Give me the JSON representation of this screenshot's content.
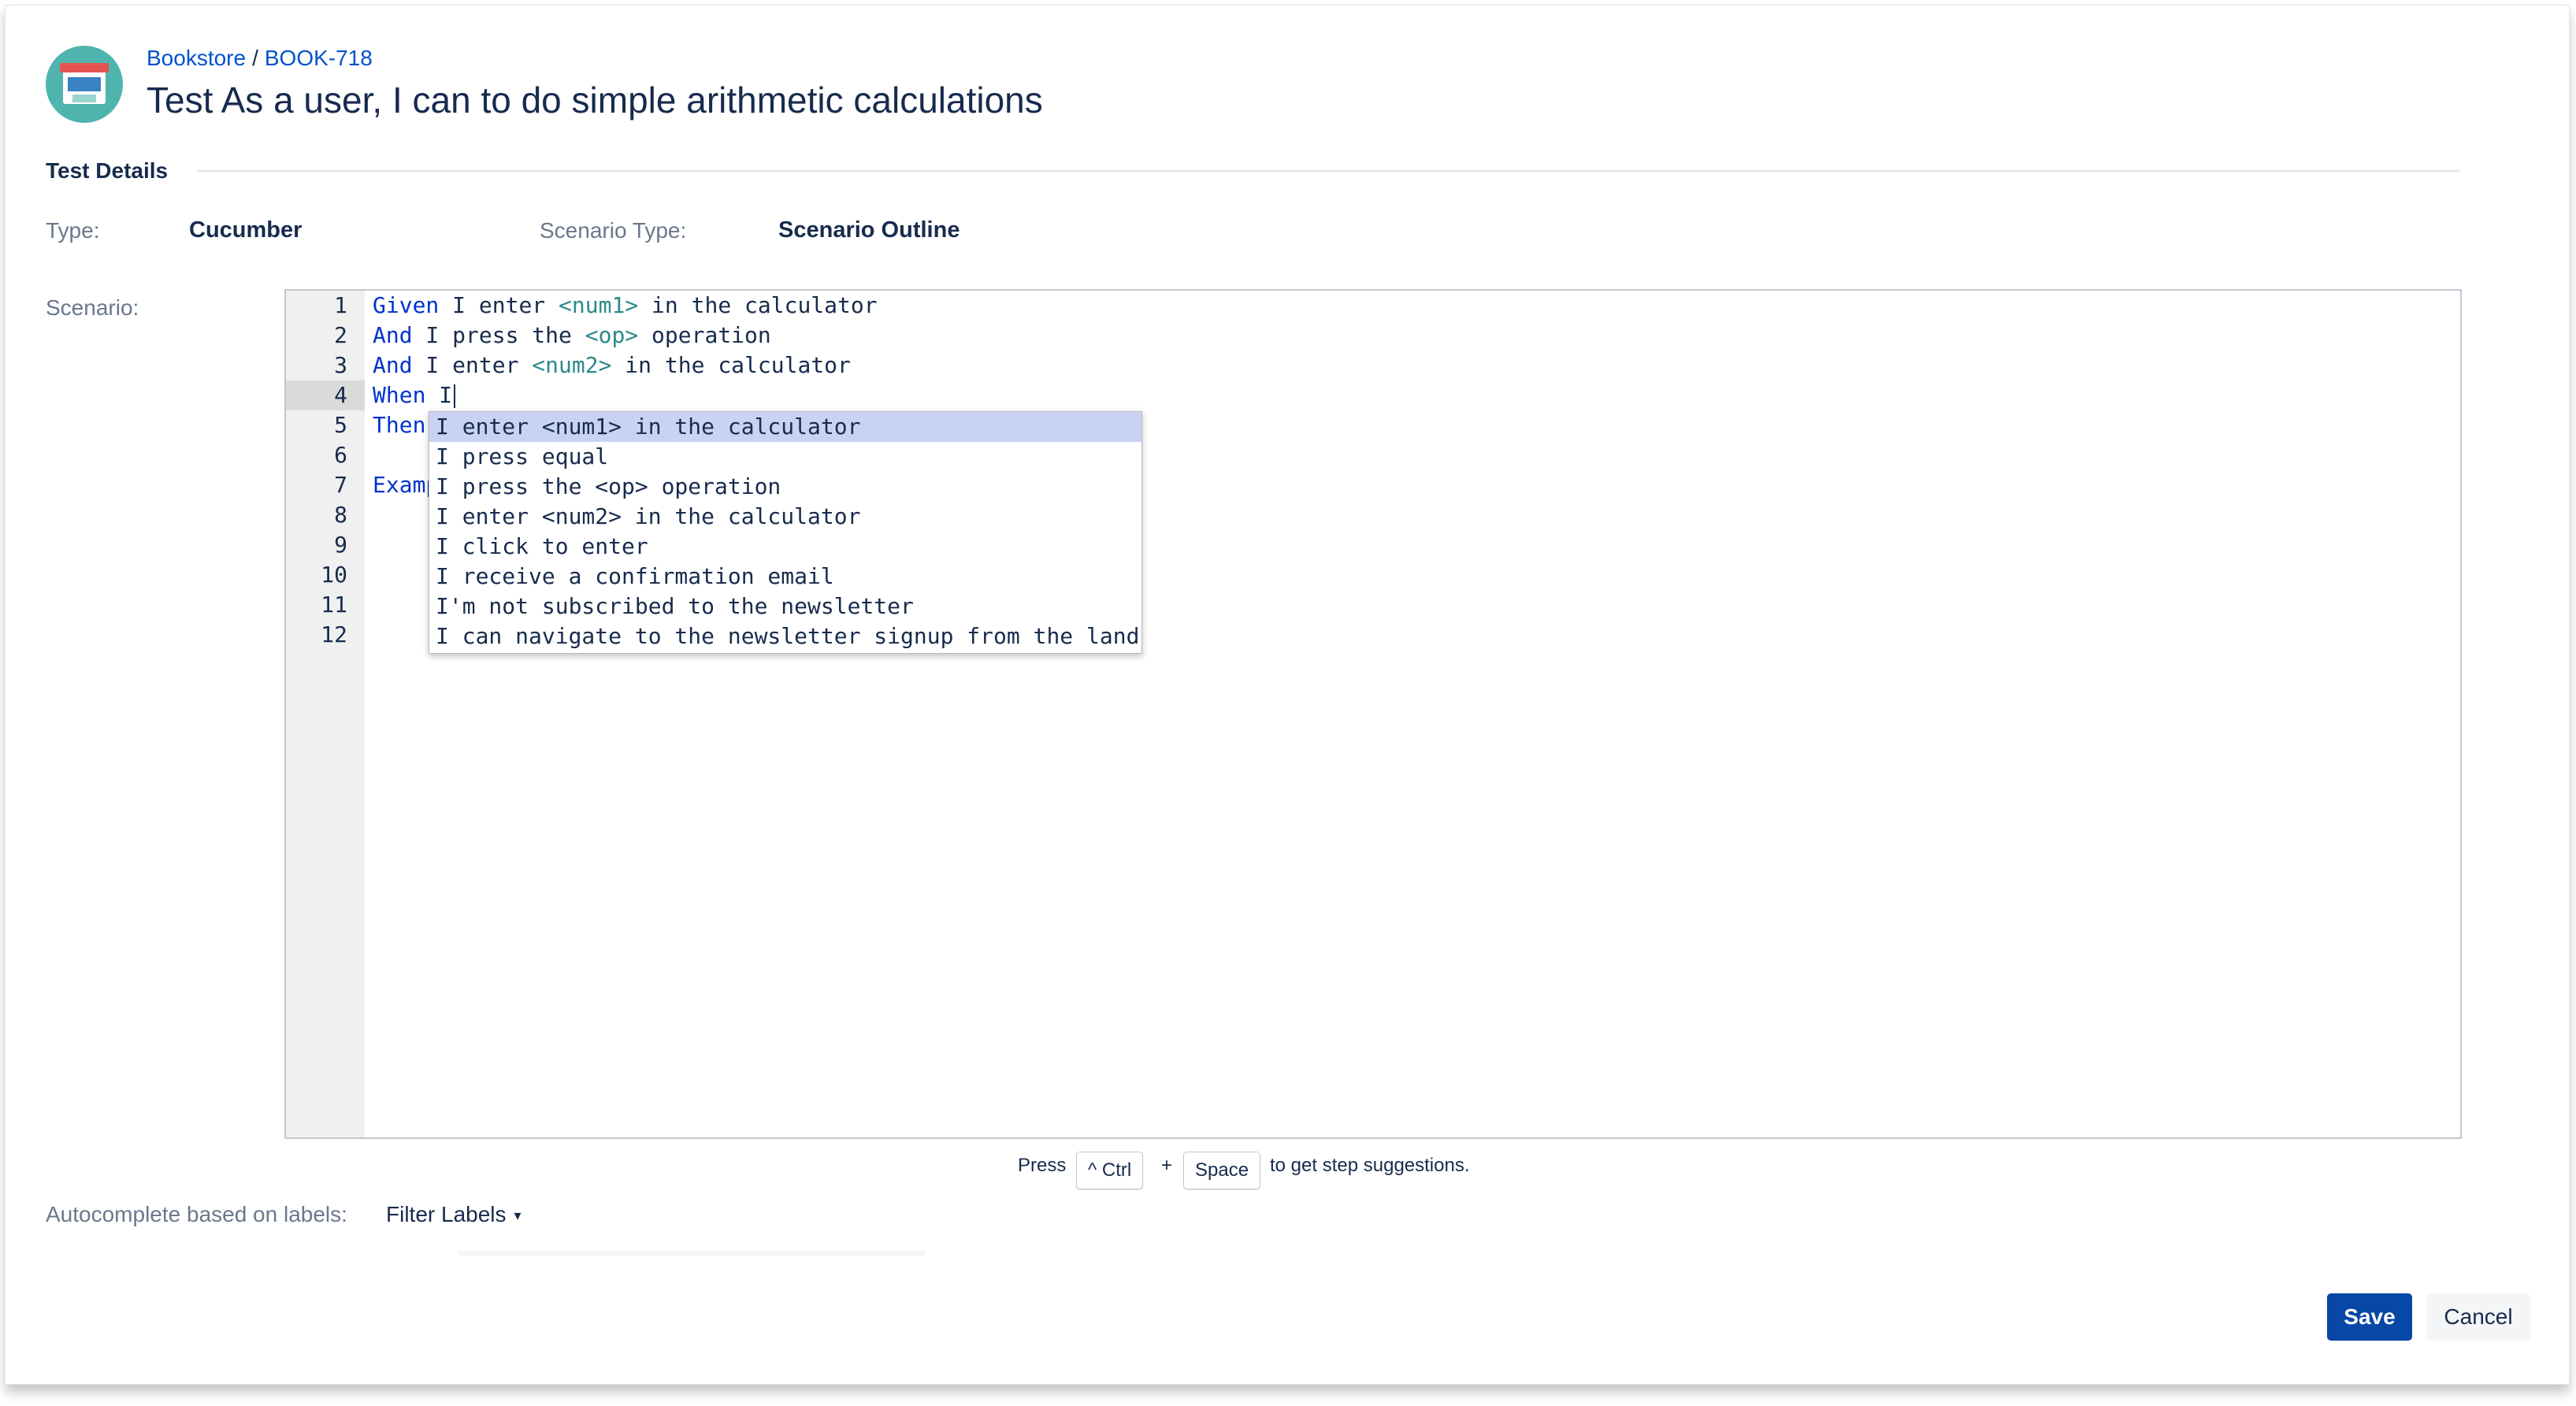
{
  "breadcrumb": {
    "project": "Bookstore",
    "separator": "/",
    "issue_key": "BOOK-718"
  },
  "title": "Test As a user, I can to do simple arithmetic calculations",
  "section": {
    "title": "Test Details"
  },
  "fields": {
    "type_label": "Type:",
    "type_value": "Cucumber",
    "scenario_type_label": "Scenario Type:",
    "scenario_type_value": "Scenario Outline",
    "scenario_label": "Scenario:"
  },
  "editor": {
    "active_line": 4,
    "lines": [
      {
        "n": "1",
        "parts": [
          {
            "t": "Given",
            "c": "kw"
          },
          {
            "t": " I enter ",
            "c": ""
          },
          {
            "t": "<num1>",
            "c": "param"
          },
          {
            "t": " in the calculator",
            "c": ""
          }
        ]
      },
      {
        "n": "2",
        "parts": [
          {
            "t": "And",
            "c": "kw"
          },
          {
            "t": " I press the ",
            "c": ""
          },
          {
            "t": "<op>",
            "c": "param"
          },
          {
            "t": " operation",
            "c": ""
          }
        ]
      },
      {
        "n": "3",
        "parts": [
          {
            "t": "And",
            "c": "kw"
          },
          {
            "t": " I enter ",
            "c": ""
          },
          {
            "t": "<num2>",
            "c": "param"
          },
          {
            "t": " in the calculator",
            "c": ""
          }
        ]
      },
      {
        "n": "4",
        "parts": [
          {
            "t": "When",
            "c": "kw"
          },
          {
            "t": " I",
            "c": ""
          }
        ]
      },
      {
        "n": "5",
        "parts": [
          {
            "t": "Then",
            "c": "kw"
          }
        ]
      },
      {
        "n": "6",
        "parts": []
      },
      {
        "n": "7",
        "parts": [
          {
            "t": "Examp",
            "c": "kw"
          }
        ]
      },
      {
        "n": "8",
        "parts": []
      },
      {
        "n": "9",
        "parts": []
      },
      {
        "n": "10",
        "parts": []
      },
      {
        "n": "11",
        "parts": []
      },
      {
        "n": "12",
        "parts": []
      }
    ]
  },
  "autocomplete": {
    "selected_index": 0,
    "items": [
      "I enter <num1> in the calculator",
      "I press equal",
      "I press the <op> operation",
      "I enter <num2> in the calculator",
      "I click to enter",
      "I receive a confirmation email",
      "I'm not subscribed to the newsletter",
      "I can navigate to the newsletter signup from the land"
    ]
  },
  "hint": {
    "press": "Press",
    "ctrl_key": "^ Ctrl",
    "plus": "+",
    "space_key": "Space",
    "suffix": "to get step suggestions."
  },
  "labels_filter": {
    "label": "Autocomplete based on labels:",
    "button": "Filter Labels",
    "caret_icon": "▾"
  },
  "actions": {
    "save": "Save",
    "cancel": "Cancel"
  },
  "colors": {
    "accent": "#0747a6",
    "link": "#0052cc",
    "avatar": "#4fb4ad",
    "keyword": "#0033cc",
    "param": "#2d8a8a",
    "selection": "#c9d2f4"
  }
}
